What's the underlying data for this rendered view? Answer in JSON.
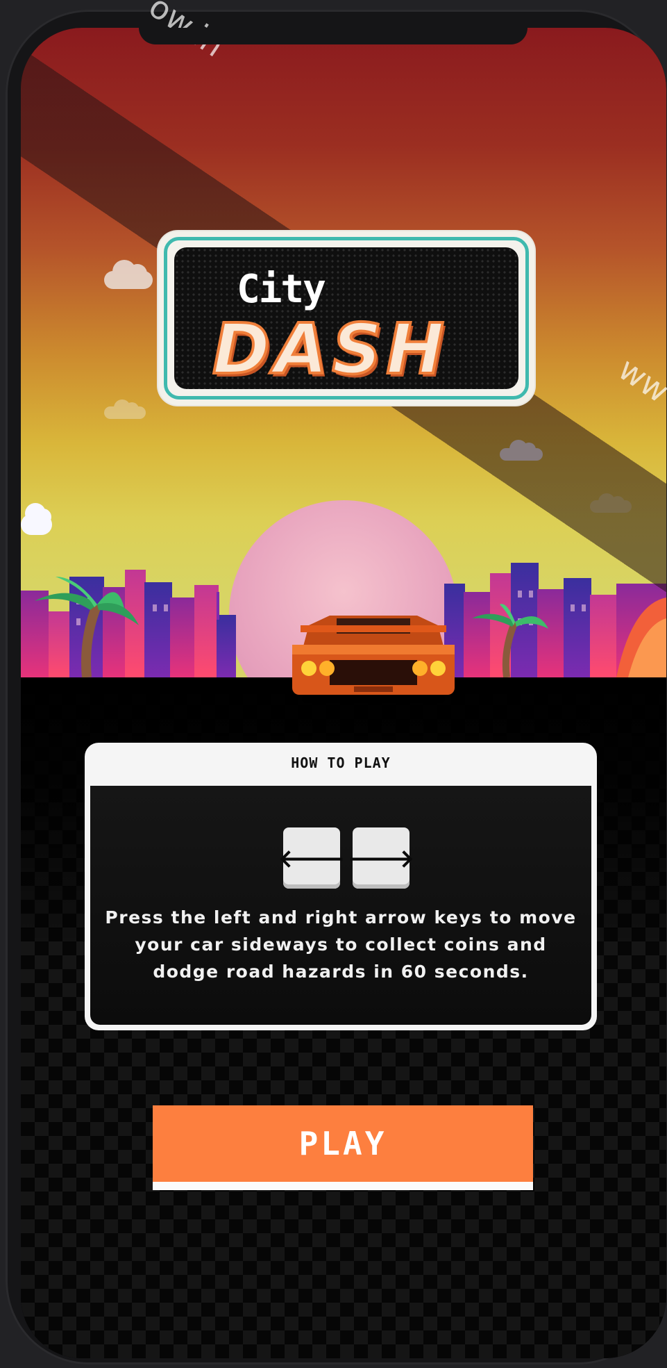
{
  "game": {
    "logo_city": "City",
    "logo_dash": "DASH"
  },
  "how_to_play": {
    "title": "HOW TO PLAY",
    "keys": [
      {
        "name": "left-arrow-key",
        "glyph": "🡐"
      },
      {
        "name": "right-arrow-key",
        "glyph": "🡒"
      }
    ],
    "instructions": "Press the left and right arrow keys to move your car sideways to collect coins and dodge road hazards in 60 seconds."
  },
  "play_button": {
    "label": "PLAY"
  },
  "watermark": {
    "top": "ow.in",
    "right": "ww"
  },
  "colors": {
    "accent": "#fd7f3f",
    "logo_border": "#3fb9ae"
  }
}
